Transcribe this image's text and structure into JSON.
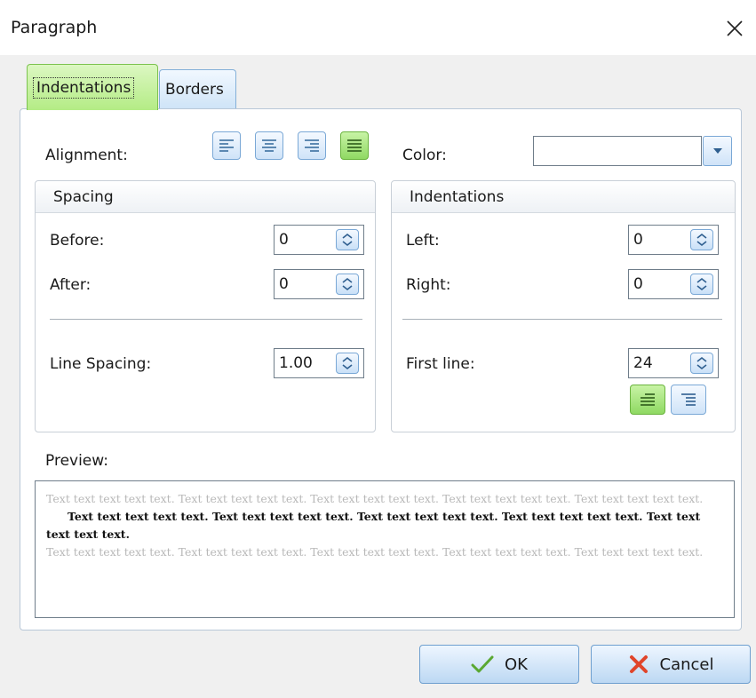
{
  "window": {
    "title": "Paragraph"
  },
  "tabs": [
    {
      "label": "Indentations"
    },
    {
      "label": "Borders"
    }
  ],
  "alignment": {
    "label": "Alignment:",
    "buttons": [
      "align-left",
      "align-center",
      "align-right",
      "align-justify"
    ],
    "selected": "align-justify"
  },
  "color": {
    "label": "Color:",
    "value": ""
  },
  "spacing": {
    "title": "Spacing",
    "before_label": "Before:",
    "before_value": "0",
    "after_label": "After:",
    "after_value": "0",
    "line_label": "Line Spacing:",
    "line_value": "1.00"
  },
  "indentations": {
    "title": "Indentations",
    "left_label": "Left:",
    "left_value": "0",
    "right_label": "Right:",
    "right_value": "0",
    "first_label": "First line:",
    "first_value": "24",
    "first_line_mode": "indent"
  },
  "preview": {
    "label": "Preview:",
    "before_text": "Text text text text text. Text text text text text. Text text text text text. Text text text text text. Text text text text text.",
    "current_text": "Text text text text text. Text text text text text. Text text text text text. Text text text  text text. Text text text text text.",
    "after_text": "Text text text text text. Text text text text text. Text text text text text. Text text text text text. Text text text text text."
  },
  "buttons": {
    "ok": "OK",
    "cancel": "Cancel"
  },
  "colors": {
    "accent_green": "#8fd963",
    "accent_blue": "#bcd8f3",
    "ok_check": "#5aa832",
    "cancel_x": "#e0452b"
  }
}
